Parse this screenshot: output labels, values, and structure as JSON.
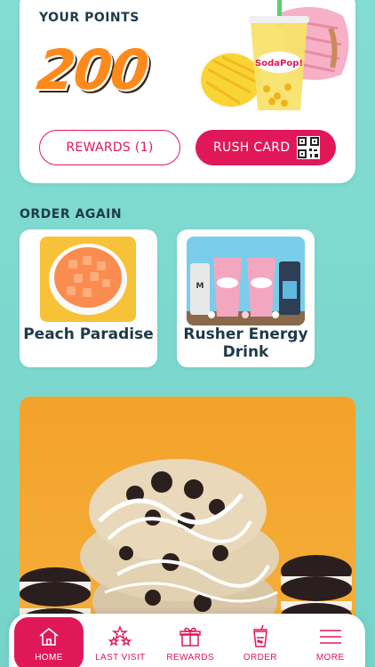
{
  "points": {
    "label": "YOUR POINTS",
    "value": "200",
    "promo_logo": "SodaPop!"
  },
  "buttons": {
    "rewards": "REWARDS (1)",
    "rush_card": "RUSH CARD"
  },
  "order_again": {
    "title": "ORDER AGAIN",
    "items": [
      {
        "name": "Peach Paradise"
      },
      {
        "name": "Rusher Energy Drink"
      }
    ]
  },
  "nav": {
    "items": [
      {
        "label": "HOME",
        "icon": "home-icon",
        "active": true
      },
      {
        "label": "LAST VISIT",
        "icon": "stars-icon",
        "active": false
      },
      {
        "label": "REWARDS",
        "icon": "gift-icon",
        "active": false
      },
      {
        "label": "ORDER",
        "icon": "cup-icon",
        "active": false
      },
      {
        "label": "MORE",
        "icon": "menu-icon",
        "active": false
      }
    ]
  },
  "colors": {
    "background": "#7fd8cf",
    "accent": "#e0185a",
    "points": "#ff8a1c",
    "hero_background": "#f3a22b"
  }
}
